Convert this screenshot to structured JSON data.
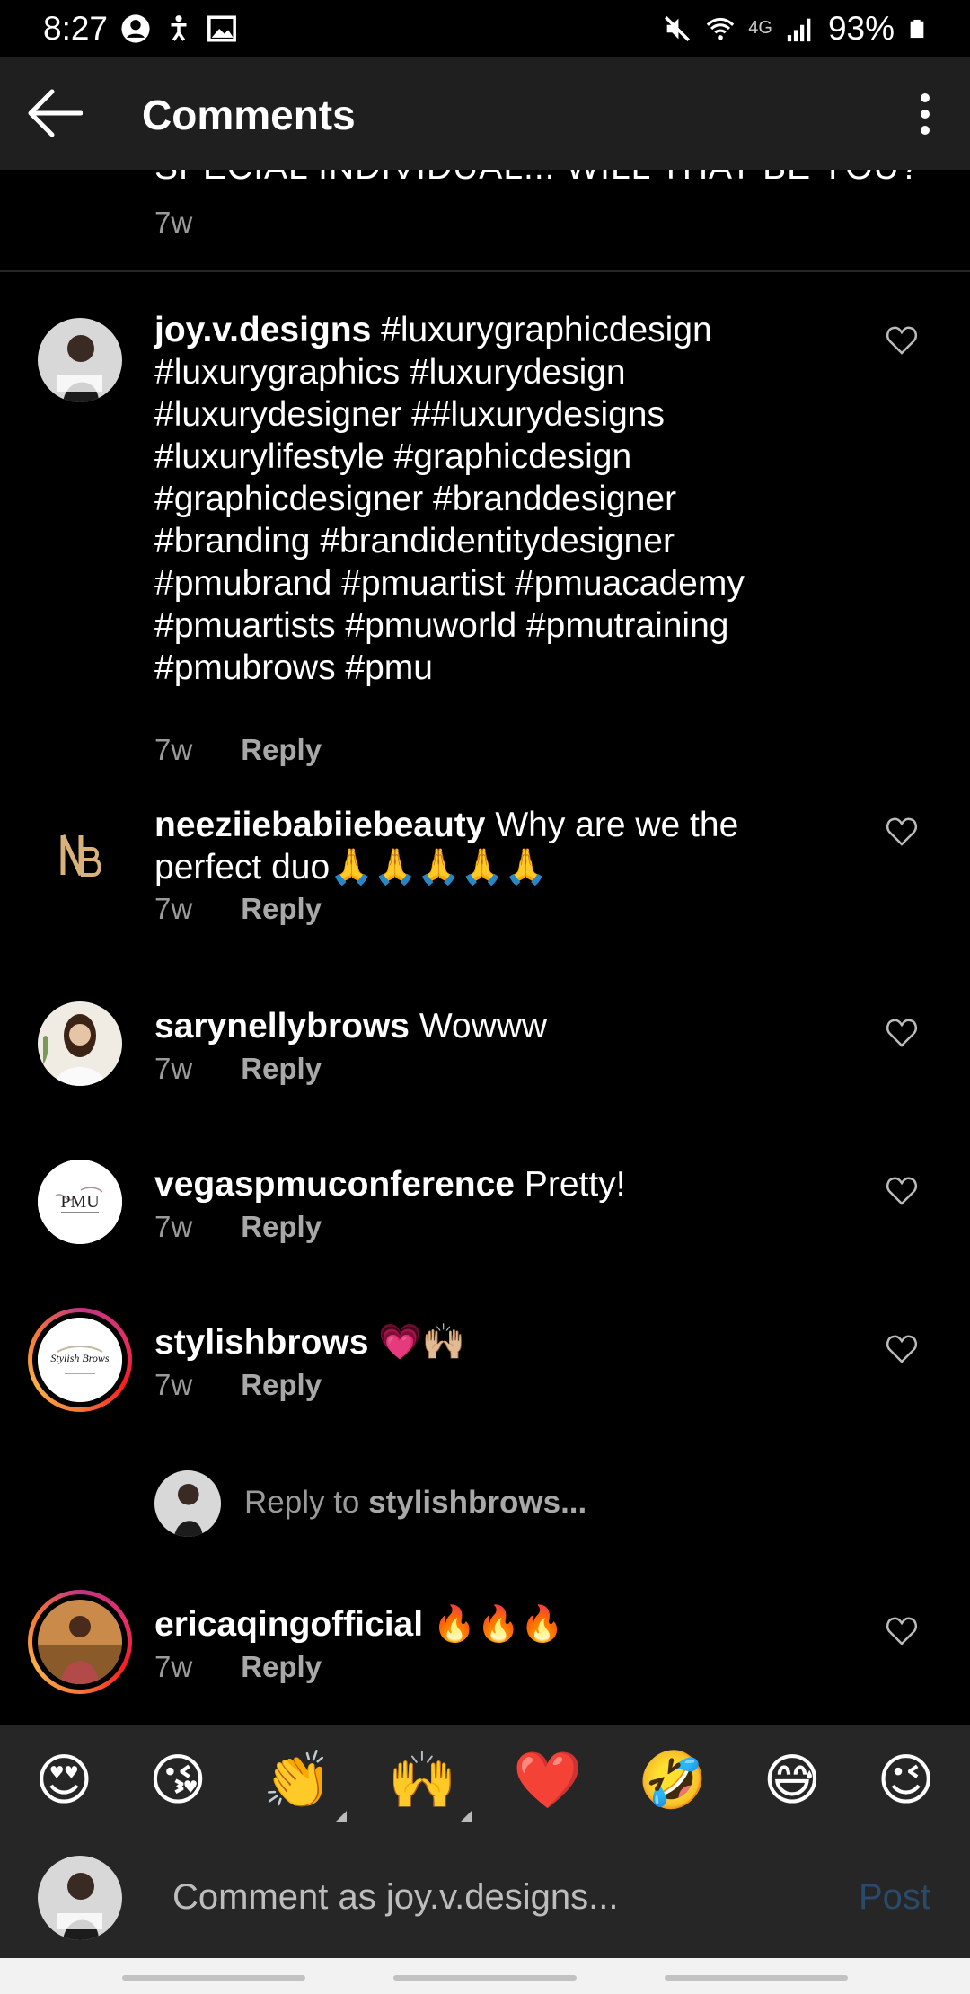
{
  "status_bar": {
    "time": "8:27",
    "network": "4G",
    "battery": "93%"
  },
  "header": {
    "title": "Comments"
  },
  "caption": {
    "tail_text": "SPECIAL INDIVIDUAL... WILL THAT BE YOU?",
    "time": "7w"
  },
  "comments": [
    {
      "username": "joy.v.designs",
      "text_lines": [
        "#luxurygraphicdesign",
        "#luxurygraphics #luxurydesign",
        "#luxurydesigner ##luxurydesigns",
        "#luxurylifestyle #graphicdesign",
        "#graphicdesigner #branddesigner",
        "#branding #brandidentitydesigner",
        "#pmubrand #pmuartist #pmuacademy",
        "#pmuartists #pmuworld #pmutraining",
        "#pmubrows #pmu"
      ],
      "time": "7w",
      "reply": "Reply"
    },
    {
      "username": "neeziiebabiiebeauty",
      "text": "Why are we the perfect duo🙏🙏🙏🙏🙏",
      "time": "7w",
      "reply": "Reply"
    },
    {
      "username": "sarynellybrows",
      "text": "Wowww",
      "time": "7w",
      "reply": "Reply"
    },
    {
      "username": "vegaspmuconference",
      "text": "Pretty!",
      "time": "7w",
      "reply": "Reply",
      "avatar_label": "PMU"
    },
    {
      "username": "stylishbrows",
      "text": "💗🙌🏼",
      "time": "7w",
      "reply": "Reply",
      "avatar_label": "Stylish Brows"
    },
    {
      "username": "ericaqingofficial",
      "text": "🔥🔥🔥",
      "time": "7w",
      "reply": "Reply"
    }
  ],
  "reply_prompt": {
    "prefix": "Reply to ",
    "target": "stylishbrows..."
  },
  "emoji_bar": [
    "😍",
    "😘",
    "👏",
    "🙌",
    "❤️",
    "🤣",
    "😅",
    "😉"
  ],
  "composer": {
    "placeholder": "Comment as joy.v.designs...",
    "post_label": "Post"
  },
  "colors": {
    "background": "#000000",
    "appbar": "#1f1f1f",
    "secondary_text": "#9a9a9a",
    "post_disabled": "#2a4a6a",
    "story_ring_start": "#c13584",
    "story_ring_end": "#fcaf45"
  },
  "icons": [
    "back-arrow-icon",
    "more-options-icon",
    "heart-icon",
    "mute-icon",
    "wifi-icon",
    "signal-icon",
    "battery-icon"
  ]
}
